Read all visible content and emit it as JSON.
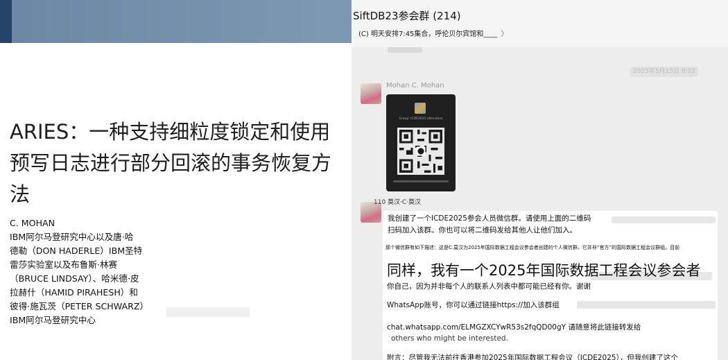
{
  "slide": {
    "title": "ARIES：一种支持细粒度锁定和使用预写日志进行部分回滚的事务恢复方法",
    "authors": [
      "C. MOHAN",
      "IBM阿尔马登研究中心以及唐·哈",
      "德勒（DON HADERLE）IBM圣特",
      "雷莎实验室以及布鲁斯·林赛",
      "（BRUCE LINDSAY）、哈米德·皮",
      "拉赫什（HAMID PIRAHESH）和",
      "彼得·施瓦茨（PETER SCHWARZ）",
      "IBM阿尔马登研究中心"
    ],
    "header_color": "#7590ac",
    "accent_color": "#234567"
  },
  "chat": {
    "title": "SiftDB23参会群 (214)",
    "pinned_message": "(C) 明天安排7:45集合，呼伦贝尔宾馆和____",
    "pinned_chevron": "〉",
    "timestamp": "2025年5月15日 8:02",
    "messages": [
      {
        "sender": "Mohan C. Mohan",
        "type": "qr-image",
        "qr_caption": "Group: ICDE2025 attendees"
      },
      {
        "sender": "110 莫汉·C·莫汉",
        "lines": [
          "我创建了一个ICDE2025参会人员微信群。请使用上面的二维码",
          "扫码加入该群。你也可以将二维码发给其他人让他们加入。",
          "那个微信群有如下描述：这是C.莫汉为2025年国际数据工程会议参会者创建的个人微信群。它并非“官方”的国际数据工程会议群组。目前",
          "同样，我有一个2025年国际数据工程会议参会者",
          "你自己，因为并非每个人的联系人列表中都可能已经有你。谢谢",
          "WhatsApp账号，你可以通过链接https://加入该群组",
          "chat.whatsapp.com/ELMGZXCYwR53s2fqQD00gY 请随意将此链接转发给",
          "others who might be interested.",
          "附言：尽管我无法前往香港参加2025年国际数据工程会议（ICDE2025），但我创建了这个"
        ]
      }
    ]
  },
  "colors": {
    "chat_bg": "#ededed",
    "bubble_bg": "#ffffff",
    "timestamp_text": "#bdbdbd"
  }
}
